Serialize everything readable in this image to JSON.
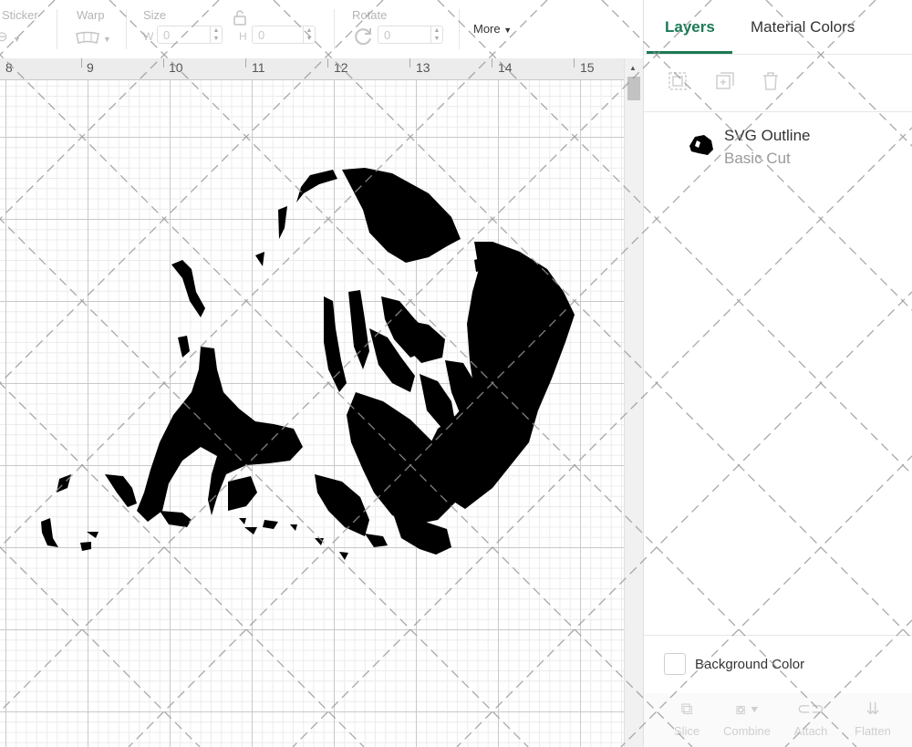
{
  "toolbar": {
    "sticker_label": "Sticker",
    "warp_label": "Warp",
    "size_label": "Size",
    "width_letter": "W",
    "width_value": "0",
    "height_letter": "H",
    "height_value": "0",
    "rotate_label": "Rotate",
    "rotate_value": "0",
    "more_label": "More"
  },
  "ruler": {
    "numbers": [
      "8",
      "9",
      "10",
      "11",
      "12",
      "13",
      "14",
      "15"
    ]
  },
  "panel": {
    "tabs": [
      {
        "label": "Layers",
        "active": true
      },
      {
        "label": "Material Colors",
        "active": false
      }
    ],
    "layer": {
      "name": "SVG Outline",
      "type": "Basic Cut"
    },
    "background_color_label": "Background Color",
    "bottom_tools": [
      {
        "label": "Slice",
        "icon": "slice-icon"
      },
      {
        "label": "Combine",
        "icon": "combine-icon"
      },
      {
        "label": "Attach",
        "icon": "attach-icon"
      },
      {
        "label": "Flatten",
        "icon": "flatten-icon"
      }
    ]
  },
  "colors": {
    "accent": "#1b7a55",
    "artwork": "#000000"
  }
}
